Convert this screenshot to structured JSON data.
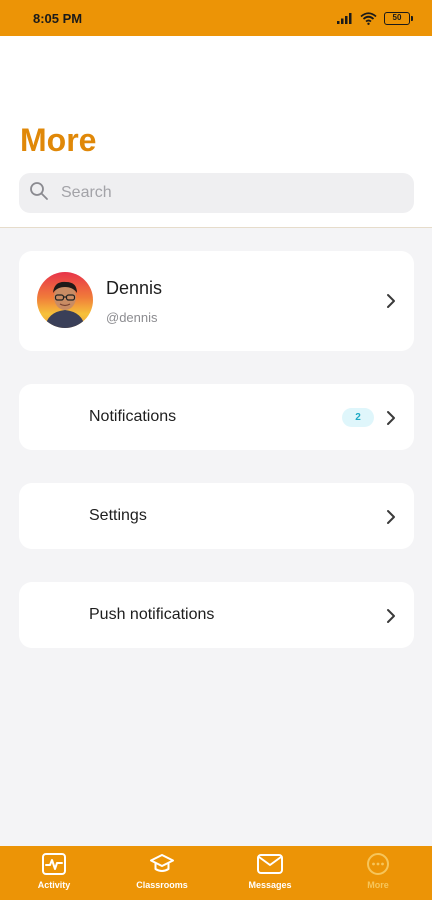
{
  "status_bar": {
    "time": "8:05 PM",
    "battery": "50",
    "icons": [
      "signal-icon",
      "wifi-icon",
      "battery-icon"
    ]
  },
  "header": {
    "title": "More",
    "search": {
      "placeholder": "Search",
      "value": "",
      "icon": "search-icon"
    }
  },
  "profile": {
    "name": "Dennis",
    "handle": "@dennis",
    "avatar_icon": "avatar"
  },
  "menu": {
    "items": [
      {
        "label": "Notifications",
        "badge": "2"
      },
      {
        "label": "Settings"
      },
      {
        "label": "Push notifications"
      }
    ]
  },
  "bottom_nav": {
    "items": [
      {
        "label": "Activity",
        "icon": "activity-icon",
        "active": false
      },
      {
        "label": "Classrooms",
        "icon": "graduation-cap-icon",
        "active": false
      },
      {
        "label": "Messages",
        "icon": "envelope-icon",
        "active": false
      },
      {
        "label": "More",
        "icon": "more-icon",
        "active": true
      }
    ]
  },
  "colors": {
    "accent": "#ec9406",
    "title": "#e08808",
    "background": "#f4f4f6",
    "card": "#ffffff",
    "badge_bg": "#dff6fb",
    "badge_text": "#1ba9c4",
    "active_nav": "#f6c55a"
  }
}
